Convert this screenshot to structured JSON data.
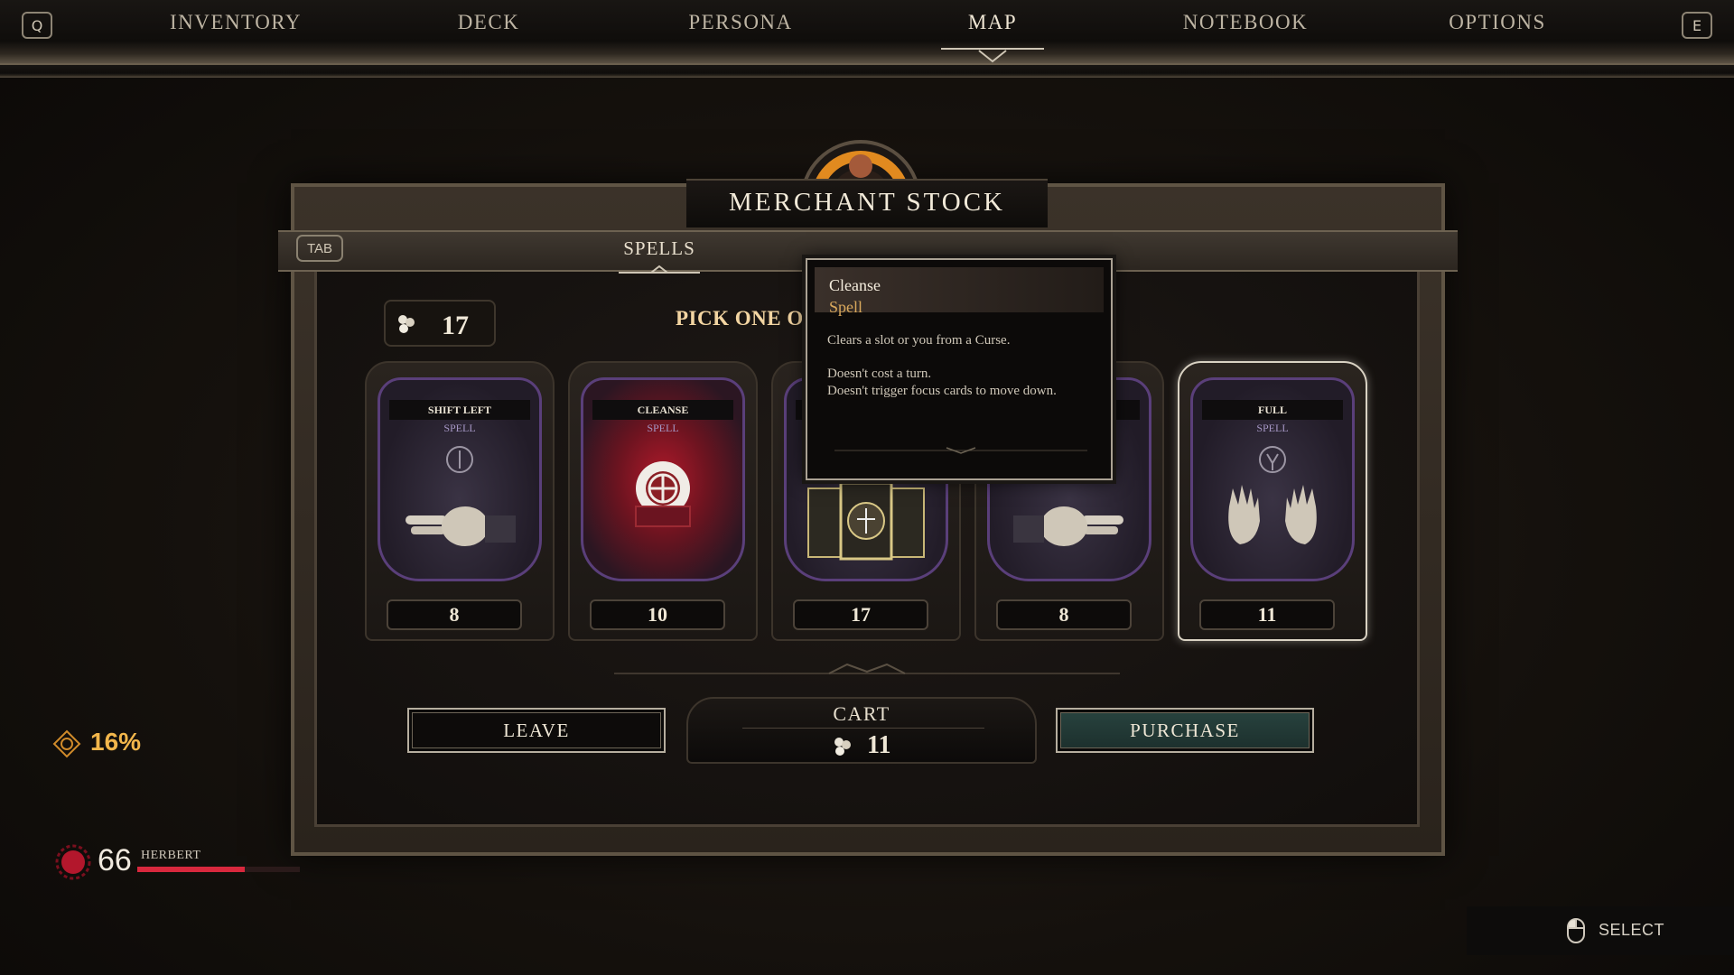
{
  "nav": {
    "left_key": "Q",
    "right_key": "E",
    "tabs": [
      {
        "label": "INVENTORY"
      },
      {
        "label": "DECK"
      },
      {
        "label": "PERSONA"
      },
      {
        "label": "MAP",
        "active": true
      },
      {
        "label": "NOTEBOOK"
      },
      {
        "label": "OPTIONS"
      }
    ]
  },
  "merchant": {
    "title": "MERCHANT STOCK",
    "tab_key": "TAB",
    "active_tab": "SPELLS",
    "coins": "17",
    "pick_text": "PICK ONE O"
  },
  "cards": [
    {
      "name": "SHIFT LEFT",
      "type": "SPELL",
      "price": "8",
      "art": "point-left-hand"
    },
    {
      "name": "CLEANSE",
      "type": "SPELL",
      "price": "10",
      "art": "sun-sigil"
    },
    {
      "name": "",
      "type": "",
      "price": "17",
      "art": "card-stack"
    },
    {
      "name": "",
      "type": "",
      "price": "8",
      "art": "point-right-hand"
    },
    {
      "name": "FULL",
      "type": "SPELL",
      "price": "11",
      "art": "open-hands",
      "selected": true
    }
  ],
  "tooltip": {
    "name": "Cleanse",
    "type": "Spell",
    "line1": "Clears a slot or you from a Curse.",
    "line2": "Doesn't cost a turn.",
    "line3": "Doesn't trigger focus cards to move down."
  },
  "actions": {
    "leave": "LEAVE",
    "cart_label": "CART",
    "cart_value": "11",
    "purchase": "PURCHASE"
  },
  "hud": {
    "corruption": "16%",
    "hp": "66",
    "player_name": "HERBERT",
    "hp_fraction": 0.66,
    "select_label": "SELECT"
  },
  "colors": {
    "accent_gold": "#f2b64b",
    "health_red": "#d8283d",
    "spell_purple": "#5a3f7a",
    "purchase_teal": "#28433f"
  }
}
